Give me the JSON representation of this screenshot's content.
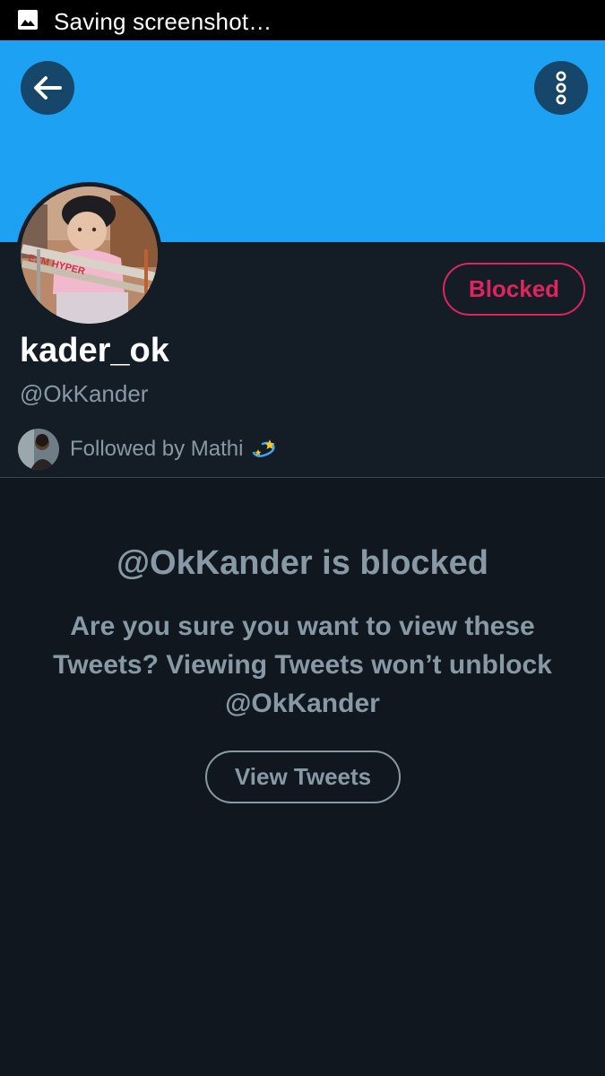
{
  "status_bar": {
    "text": "Saving screenshot…",
    "icon": "image-icon"
  },
  "header": {
    "back_icon": "arrow-left-icon",
    "more_icon": "more-vertical-icon",
    "banner_color": "#1da1f2"
  },
  "profile": {
    "display_name": "kader_ok",
    "handle": "@OkKander",
    "relationship_button": "Blocked",
    "followed_by": "Followed by Mathi",
    "followed_by_emoji": "dizzy-icon",
    "avatar_stroller_text": "ESM HYPER"
  },
  "blocked_notice": {
    "title": "@OkKander is blocked",
    "message": "Are you sure you want to view these Tweets? Viewing Tweets won’t unblock @OkKander",
    "view_button": "View Tweets"
  },
  "colors": {
    "accent": "#1da1f2",
    "blocked_red": "#e0245e",
    "muted_text": "#8899a6",
    "background": "#141d26",
    "content_background": "#10171e"
  }
}
